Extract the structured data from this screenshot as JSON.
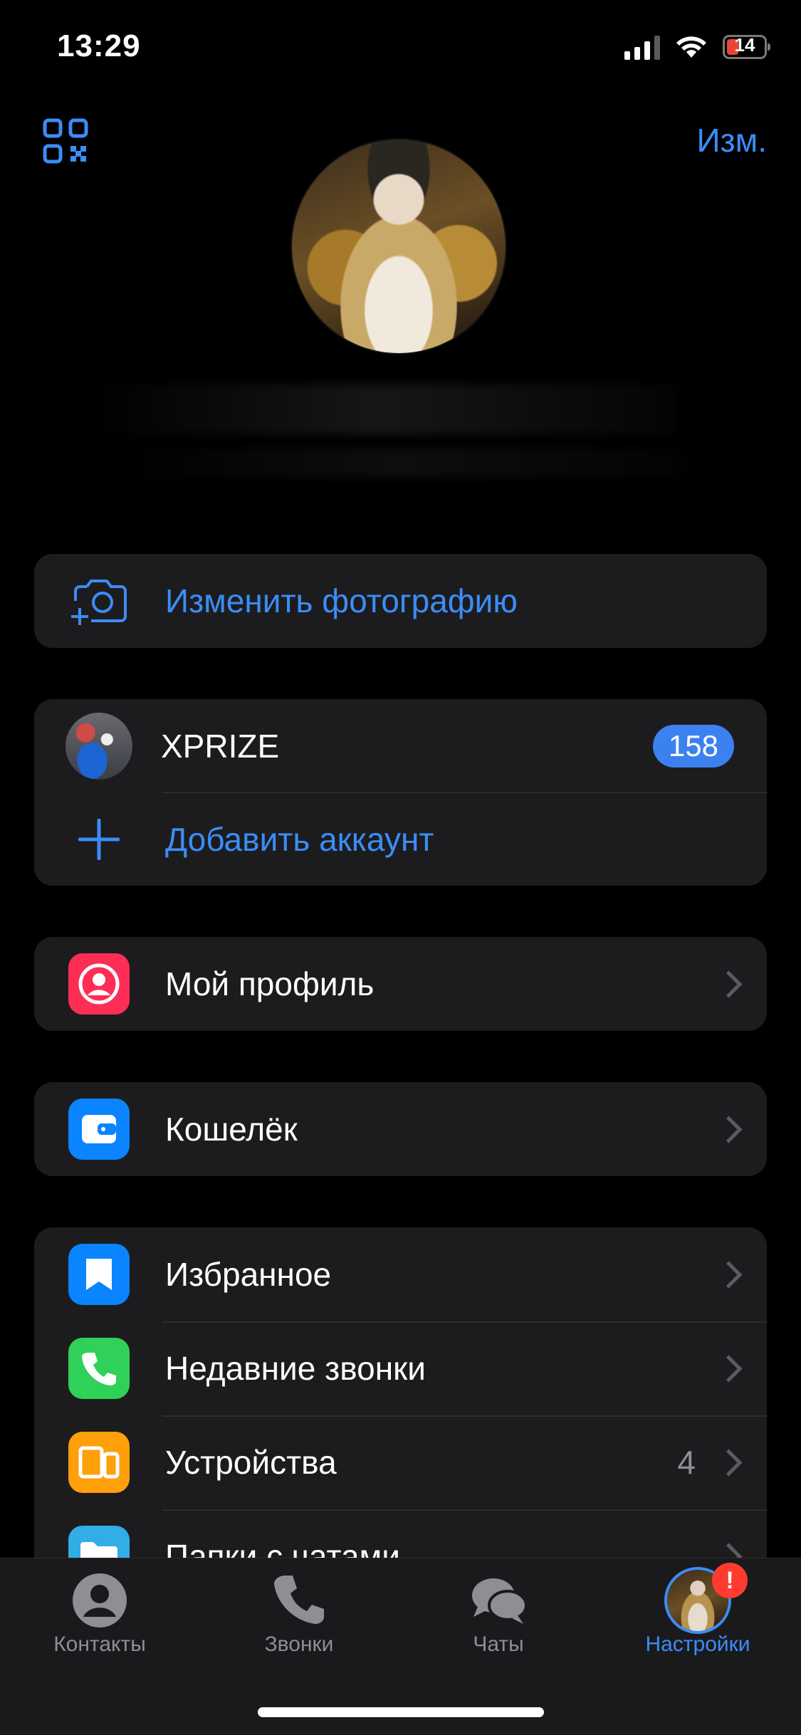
{
  "status_bar": {
    "time": "13:29",
    "battery_level": "14",
    "battery_charging": true
  },
  "header": {
    "qr_icon": "qr-code-icon",
    "edit_label": "Изм."
  },
  "change_photo": {
    "icon": "camera-add-icon",
    "label": "Изменить фотографию"
  },
  "accounts": {
    "items": [
      {
        "name": "XPRIZE",
        "badge": "158"
      }
    ],
    "add_label": "Добавить аккаунт",
    "add_icon": "plus-icon"
  },
  "profile_section": {
    "label": "Мой профиль",
    "icon": "person-circle-icon",
    "color": "#fe2d55"
  },
  "wallet_section": {
    "label": "Кошелёк",
    "icon": "wallet-icon",
    "color": "#0a84ff"
  },
  "settings_list": {
    "items": [
      {
        "label": "Избранное",
        "icon": "bookmark-icon",
        "color": "#0a84ff",
        "value": ""
      },
      {
        "label": "Недавние звонки",
        "icon": "phone-icon",
        "color": "#30d158",
        "value": ""
      },
      {
        "label": "Устройства",
        "icon": "devices-icon",
        "color": "#ff9f0a",
        "value": "4"
      },
      {
        "label": "Папки с чатами",
        "icon": "folder-icon",
        "color": "#32ade6",
        "value": ""
      }
    ]
  },
  "tabbar": {
    "tabs": [
      {
        "label": "Контакты",
        "icon": "person-icon",
        "active": false
      },
      {
        "label": "Звонки",
        "icon": "phone-icon",
        "active": false
      },
      {
        "label": "Чаты",
        "icon": "chat-bubbles-icon",
        "active": false
      },
      {
        "label": "Настройки",
        "icon": "avatar-icon",
        "active": true,
        "alert": "!"
      }
    ]
  },
  "colors": {
    "accent": "#3b8df7",
    "card_bg": "#1c1c1e",
    "alert": "#ff3b30"
  }
}
